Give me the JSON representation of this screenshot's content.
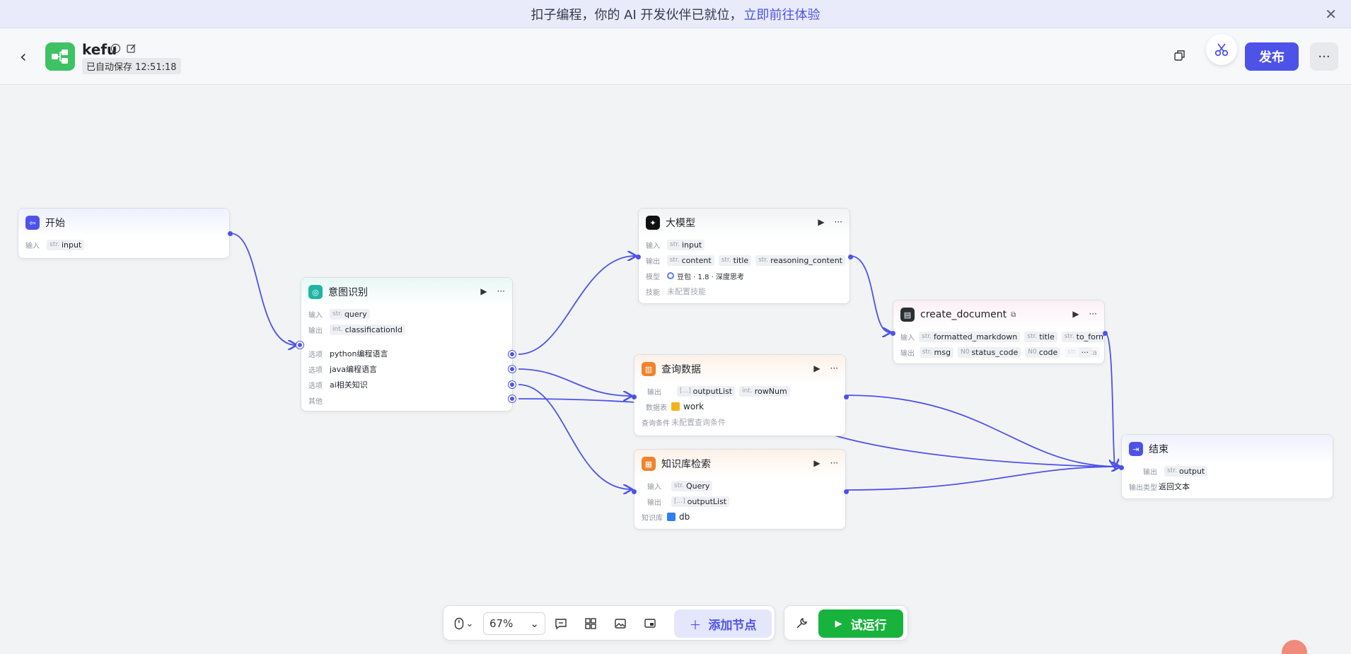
{
  "banner": {
    "text": "扣子编程，你的 AI 开发伙伴已就位，",
    "link": "立即前往体验"
  },
  "header": {
    "back_icon": "chevron-left-icon",
    "app_name": "kefu",
    "autosave": "已自动保存 12:51:18",
    "publish_label": "发布",
    "more_label": "···"
  },
  "nodes": {
    "start": {
      "title": "开始",
      "input_label": "输入",
      "input_type": "str.",
      "input_name": "input"
    },
    "intent": {
      "title": "意图识别",
      "input_label": "输入",
      "input_type": "str.",
      "input_name": "query",
      "output_label": "输出",
      "output_type": "int.",
      "output_name": "classificationId",
      "options": [
        {
          "label": "选项",
          "value": "python编程语言"
        },
        {
          "label": "选项",
          "value": "java编程语言"
        },
        {
          "label": "选项",
          "value": "ai相关知识"
        }
      ],
      "other": "其他"
    },
    "llm": {
      "title": "大模型",
      "input_label": "输入",
      "input_tag_type": "str.",
      "input_tag": "input",
      "output_label": "输出",
      "outputs": [
        {
          "type": "str.",
          "name": "content"
        },
        {
          "type": "str.",
          "name": "title"
        },
        {
          "type": "str.",
          "name": "reasoning_content"
        }
      ],
      "model_label": "模型",
      "model_value": "豆包 · 1.8 · 深度思考",
      "skill_label": "技能",
      "skill_value": "未配置技能"
    },
    "create_document": {
      "title": "create_document",
      "input_label": "输入",
      "inputs": [
        {
          "type": "str.",
          "name": "formatted_markdown"
        },
        {
          "type": "str.",
          "name": "title"
        },
        {
          "type": "str.",
          "name": "to_format"
        }
      ],
      "output_label": "输出",
      "outputs": [
        {
          "type": "str.",
          "name": "msg"
        },
        {
          "type": "N0",
          "name": "status_code"
        },
        {
          "type": "N0",
          "name": "code"
        },
        {
          "type": "str.",
          "name": "data"
        }
      ],
      "more": "···"
    },
    "query_data": {
      "title": "查询数据",
      "output_label": "输出",
      "outputs": [
        {
          "type": "[...]",
          "name": "outputList"
        },
        {
          "type": "int.",
          "name": "rowNum"
        }
      ],
      "table_label": "数据表",
      "table_value": "work",
      "cond_label": "查询条件",
      "cond_value": "未配置查询条件"
    },
    "knowledge": {
      "title": "知识库检索",
      "input_label": "输入",
      "input_type": "str.",
      "input_name": "Query",
      "output_label": "输出",
      "output_type": "[...]",
      "output_name": "outputList",
      "kb_label": "知识库",
      "kb_value": "db"
    },
    "end": {
      "title": "结束",
      "output_label": "输出",
      "output_type": "str.",
      "output_name": "output",
      "output_type_label": "输出类型",
      "output_type_value": "返回文本"
    }
  },
  "toolbar": {
    "zoom": "67%",
    "add_node": "添加节点",
    "run": "试运行"
  },
  "colors": {
    "accent": "#4d53e8",
    "run_green": "#17b33c",
    "start_icon": "#4d53e8",
    "intent_icon": "#1fb5a6",
    "llm_icon": "#111111",
    "data_icon": "#f0832c",
    "end_icon": "#4d53e8"
  }
}
